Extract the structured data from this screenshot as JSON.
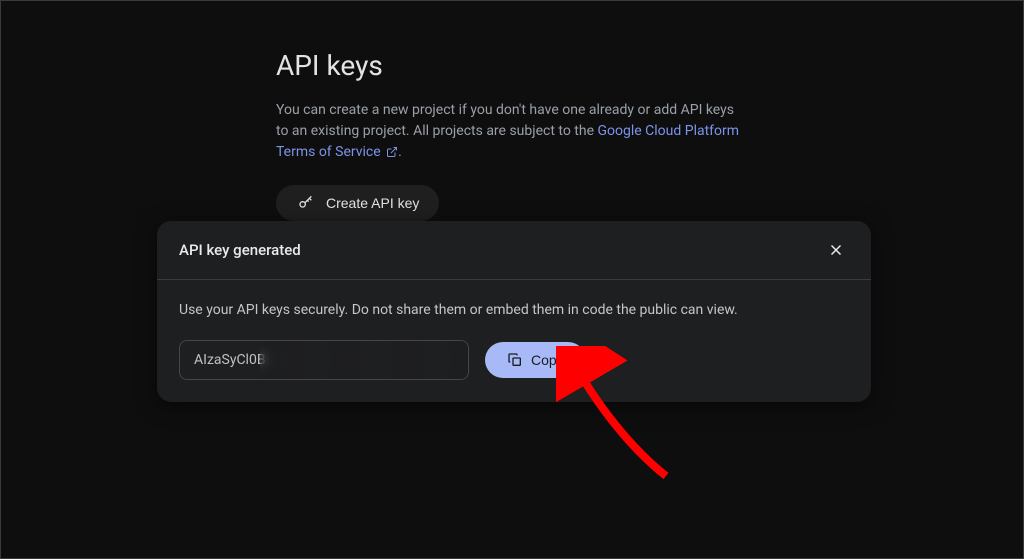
{
  "page": {
    "title": "API keys",
    "description_prefix": "You can create a new project if you don't have one already or add API keys to an existing project. All projects are subject to the ",
    "terms_link": "Google Cloud Platform Terms of Service",
    "description_suffix": "."
  },
  "create_button": {
    "label": "Create API key"
  },
  "dialog": {
    "title": "API key generated",
    "description": "Use your API keys securely. Do not share them or embed them in code the public can view.",
    "api_key_value": "AIzaSyCl0B",
    "copy_label": "Copy"
  }
}
